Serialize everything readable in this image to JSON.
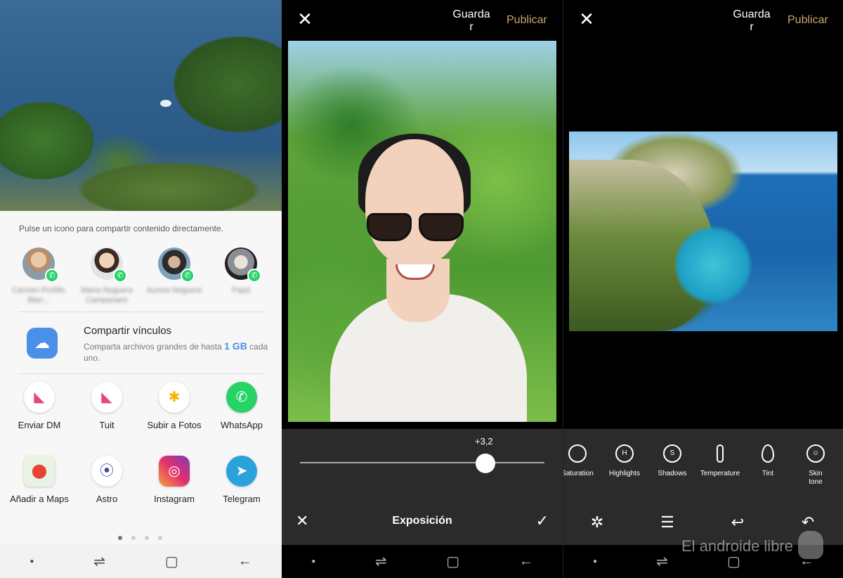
{
  "share_sheet": {
    "hint": "Pulse un icono para compartir contenido directamente.",
    "contacts": [
      {
        "name": "Carmen Portillo Blan..."
      },
      {
        "name": "María Noguera Campanario"
      },
      {
        "name": "Aurora Noguera"
      },
      {
        "name": "Papá"
      }
    ],
    "share_links": {
      "title": "Compartir vínculos",
      "description": "Comparta archivos grandes de hasta",
      "size": "1 GB",
      "suffix": "cada uno."
    },
    "apps": [
      {
        "label": "Enviar DM",
        "icon": "twitter-dm-icon"
      },
      {
        "label": "Tuit",
        "icon": "twitter-icon"
      },
      {
        "label": "Subir a Fotos",
        "icon": "google-photos-icon"
      },
      {
        "label": "WhatsApp",
        "icon": "whatsapp-icon"
      },
      {
        "label": "Añadir a Maps",
        "icon": "google-maps-icon"
      },
      {
        "label": "Astro",
        "icon": "astro-icon"
      },
      {
        "label": "Instagram",
        "icon": "instagram-icon"
      },
      {
        "label": "Telegram",
        "icon": "telegram-icon"
      }
    ],
    "page_dots": 4,
    "active_page": 1
  },
  "editor_exposure": {
    "save_label": "Guarda r",
    "publish_label": "Publicar",
    "slider_value": "+3,2",
    "slider_fraction": 0.76,
    "title": "Exposición"
  },
  "editor_tools": {
    "save_label": "Guarda r",
    "publish_label": "Publicar",
    "tools": [
      {
        "label": "Saturation",
        "icon": "saturation-icon"
      },
      {
        "label": "Highlights",
        "icon": "highlights-icon"
      },
      {
        "label": "Shadows",
        "icon": "shadows-icon"
      },
      {
        "label": "Temperature",
        "icon": "temperature-icon"
      },
      {
        "label": "Tint",
        "icon": "tint-icon"
      },
      {
        "label": "Skin tone",
        "icon": "skin-tone-icon"
      }
    ]
  },
  "watermark": "El androide libre",
  "colors": {
    "accent_gold": "#c9a66b",
    "link_blue": "#4a8fe8",
    "whatsapp_green": "#25d366"
  }
}
